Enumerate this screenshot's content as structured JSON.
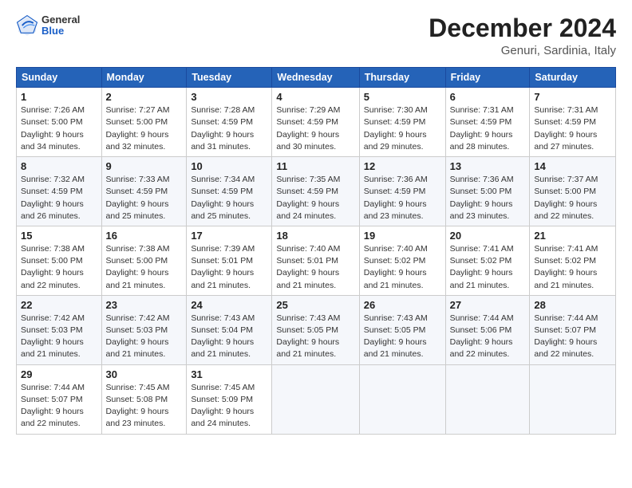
{
  "header": {
    "logo": {
      "general": "General",
      "blue": "Blue"
    },
    "month": "December 2024",
    "location": "Genuri, Sardinia, Italy"
  },
  "weekdays": [
    "Sunday",
    "Monday",
    "Tuesday",
    "Wednesday",
    "Thursday",
    "Friday",
    "Saturday"
  ],
  "weeks": [
    [
      {
        "day": "1",
        "sunrise": "Sunrise: 7:26 AM",
        "sunset": "Sunset: 5:00 PM",
        "daylight": "Daylight: 9 hours and 34 minutes."
      },
      {
        "day": "2",
        "sunrise": "Sunrise: 7:27 AM",
        "sunset": "Sunset: 5:00 PM",
        "daylight": "Daylight: 9 hours and 32 minutes."
      },
      {
        "day": "3",
        "sunrise": "Sunrise: 7:28 AM",
        "sunset": "Sunset: 4:59 PM",
        "daylight": "Daylight: 9 hours and 31 minutes."
      },
      {
        "day": "4",
        "sunrise": "Sunrise: 7:29 AM",
        "sunset": "Sunset: 4:59 PM",
        "daylight": "Daylight: 9 hours and 30 minutes."
      },
      {
        "day": "5",
        "sunrise": "Sunrise: 7:30 AM",
        "sunset": "Sunset: 4:59 PM",
        "daylight": "Daylight: 9 hours and 29 minutes."
      },
      {
        "day": "6",
        "sunrise": "Sunrise: 7:31 AM",
        "sunset": "Sunset: 4:59 PM",
        "daylight": "Daylight: 9 hours and 28 minutes."
      },
      {
        "day": "7",
        "sunrise": "Sunrise: 7:31 AM",
        "sunset": "Sunset: 4:59 PM",
        "daylight": "Daylight: 9 hours and 27 minutes."
      }
    ],
    [
      {
        "day": "8",
        "sunrise": "Sunrise: 7:32 AM",
        "sunset": "Sunset: 4:59 PM",
        "daylight": "Daylight: 9 hours and 26 minutes."
      },
      {
        "day": "9",
        "sunrise": "Sunrise: 7:33 AM",
        "sunset": "Sunset: 4:59 PM",
        "daylight": "Daylight: 9 hours and 25 minutes."
      },
      {
        "day": "10",
        "sunrise": "Sunrise: 7:34 AM",
        "sunset": "Sunset: 4:59 PM",
        "daylight": "Daylight: 9 hours and 25 minutes."
      },
      {
        "day": "11",
        "sunrise": "Sunrise: 7:35 AM",
        "sunset": "Sunset: 4:59 PM",
        "daylight": "Daylight: 9 hours and 24 minutes."
      },
      {
        "day": "12",
        "sunrise": "Sunrise: 7:36 AM",
        "sunset": "Sunset: 4:59 PM",
        "daylight": "Daylight: 9 hours and 23 minutes."
      },
      {
        "day": "13",
        "sunrise": "Sunrise: 7:36 AM",
        "sunset": "Sunset: 5:00 PM",
        "daylight": "Daylight: 9 hours and 23 minutes."
      },
      {
        "day": "14",
        "sunrise": "Sunrise: 7:37 AM",
        "sunset": "Sunset: 5:00 PM",
        "daylight": "Daylight: 9 hours and 22 minutes."
      }
    ],
    [
      {
        "day": "15",
        "sunrise": "Sunrise: 7:38 AM",
        "sunset": "Sunset: 5:00 PM",
        "daylight": "Daylight: 9 hours and 22 minutes."
      },
      {
        "day": "16",
        "sunrise": "Sunrise: 7:38 AM",
        "sunset": "Sunset: 5:00 PM",
        "daylight": "Daylight: 9 hours and 21 minutes."
      },
      {
        "day": "17",
        "sunrise": "Sunrise: 7:39 AM",
        "sunset": "Sunset: 5:01 PM",
        "daylight": "Daylight: 9 hours and 21 minutes."
      },
      {
        "day": "18",
        "sunrise": "Sunrise: 7:40 AM",
        "sunset": "Sunset: 5:01 PM",
        "daylight": "Daylight: 9 hours and 21 minutes."
      },
      {
        "day": "19",
        "sunrise": "Sunrise: 7:40 AM",
        "sunset": "Sunset: 5:02 PM",
        "daylight": "Daylight: 9 hours and 21 minutes."
      },
      {
        "day": "20",
        "sunrise": "Sunrise: 7:41 AM",
        "sunset": "Sunset: 5:02 PM",
        "daylight": "Daylight: 9 hours and 21 minutes."
      },
      {
        "day": "21",
        "sunrise": "Sunrise: 7:41 AM",
        "sunset": "Sunset: 5:02 PM",
        "daylight": "Daylight: 9 hours and 21 minutes."
      }
    ],
    [
      {
        "day": "22",
        "sunrise": "Sunrise: 7:42 AM",
        "sunset": "Sunset: 5:03 PM",
        "daylight": "Daylight: 9 hours and 21 minutes."
      },
      {
        "day": "23",
        "sunrise": "Sunrise: 7:42 AM",
        "sunset": "Sunset: 5:03 PM",
        "daylight": "Daylight: 9 hours and 21 minutes."
      },
      {
        "day": "24",
        "sunrise": "Sunrise: 7:43 AM",
        "sunset": "Sunset: 5:04 PM",
        "daylight": "Daylight: 9 hours and 21 minutes."
      },
      {
        "day": "25",
        "sunrise": "Sunrise: 7:43 AM",
        "sunset": "Sunset: 5:05 PM",
        "daylight": "Daylight: 9 hours and 21 minutes."
      },
      {
        "day": "26",
        "sunrise": "Sunrise: 7:43 AM",
        "sunset": "Sunset: 5:05 PM",
        "daylight": "Daylight: 9 hours and 21 minutes."
      },
      {
        "day": "27",
        "sunrise": "Sunrise: 7:44 AM",
        "sunset": "Sunset: 5:06 PM",
        "daylight": "Daylight: 9 hours and 22 minutes."
      },
      {
        "day": "28",
        "sunrise": "Sunrise: 7:44 AM",
        "sunset": "Sunset: 5:07 PM",
        "daylight": "Daylight: 9 hours and 22 minutes."
      }
    ],
    [
      {
        "day": "29",
        "sunrise": "Sunrise: 7:44 AM",
        "sunset": "Sunset: 5:07 PM",
        "daylight": "Daylight: 9 hours and 22 minutes."
      },
      {
        "day": "30",
        "sunrise": "Sunrise: 7:45 AM",
        "sunset": "Sunset: 5:08 PM",
        "daylight": "Daylight: 9 hours and 23 minutes."
      },
      {
        "day": "31",
        "sunrise": "Sunrise: 7:45 AM",
        "sunset": "Sunset: 5:09 PM",
        "daylight": "Daylight: 9 hours and 24 minutes."
      },
      null,
      null,
      null,
      null
    ]
  ]
}
